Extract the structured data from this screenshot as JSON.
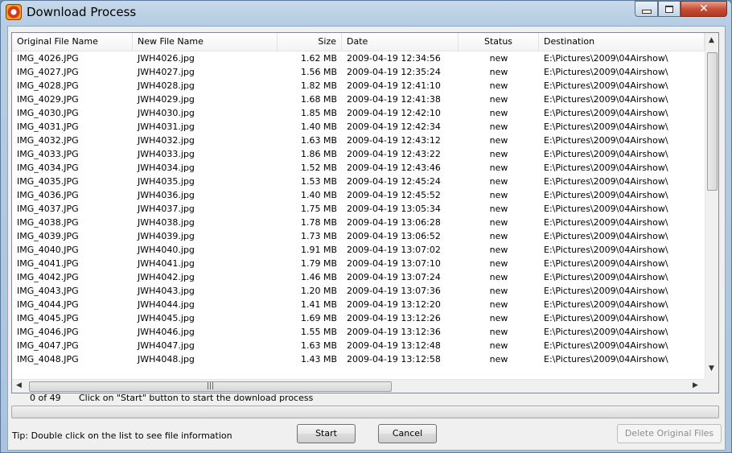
{
  "window": {
    "title": "Download Process",
    "title_color": "#000000",
    "accent": "#5b7799"
  },
  "icons": {
    "app": "app-icon",
    "minimize": "minimize-icon",
    "maximize": "maximize-icon",
    "close": "close-icon"
  },
  "table": {
    "columns": [
      "Original File Name",
      "New File Name",
      "Size",
      "Date",
      "Status",
      "Destination"
    ],
    "rows": [
      [
        "IMG_4026.JPG",
        "JWH4026.jpg",
        "1.62 MB",
        "2009-04-19 12:34:56",
        "new",
        "E:\\Pictures\\2009\\04Airshow\\"
      ],
      [
        "IMG_4027.JPG",
        "JWH4027.jpg",
        "1.56 MB",
        "2009-04-19 12:35:24",
        "new",
        "E:\\Pictures\\2009\\04Airshow\\"
      ],
      [
        "IMG_4028.JPG",
        "JWH4028.jpg",
        "1.82 MB",
        "2009-04-19 12:41:10",
        "new",
        "E:\\Pictures\\2009\\04Airshow\\"
      ],
      [
        "IMG_4029.JPG",
        "JWH4029.jpg",
        "1.68 MB",
        "2009-04-19 12:41:38",
        "new",
        "E:\\Pictures\\2009\\04Airshow\\"
      ],
      [
        "IMG_4030.JPG",
        "JWH4030.jpg",
        "1.85 MB",
        "2009-04-19 12:42:10",
        "new",
        "E:\\Pictures\\2009\\04Airshow\\"
      ],
      [
        "IMG_4031.JPG",
        "JWH4031.jpg",
        "1.40 MB",
        "2009-04-19 12:42:34",
        "new",
        "E:\\Pictures\\2009\\04Airshow\\"
      ],
      [
        "IMG_4032.JPG",
        "JWH4032.jpg",
        "1.63 MB",
        "2009-04-19 12:43:12",
        "new",
        "E:\\Pictures\\2009\\04Airshow\\"
      ],
      [
        "IMG_4033.JPG",
        "JWH4033.jpg",
        "1.86 MB",
        "2009-04-19 12:43:22",
        "new",
        "E:\\Pictures\\2009\\04Airshow\\"
      ],
      [
        "IMG_4034.JPG",
        "JWH4034.jpg",
        "1.52 MB",
        "2009-04-19 12:43:46",
        "new",
        "E:\\Pictures\\2009\\04Airshow\\"
      ],
      [
        "IMG_4035.JPG",
        "JWH4035.jpg",
        "1.53 MB",
        "2009-04-19 12:45:24",
        "new",
        "E:\\Pictures\\2009\\04Airshow\\"
      ],
      [
        "IMG_4036.JPG",
        "JWH4036.jpg",
        "1.40 MB",
        "2009-04-19 12:45:52",
        "new",
        "E:\\Pictures\\2009\\04Airshow\\"
      ],
      [
        "IMG_4037.JPG",
        "JWH4037.jpg",
        "1.75 MB",
        "2009-04-19 13:05:34",
        "new",
        "E:\\Pictures\\2009\\04Airshow\\"
      ],
      [
        "IMG_4038.JPG",
        "JWH4038.jpg",
        "1.78 MB",
        "2009-04-19 13:06:28",
        "new",
        "E:\\Pictures\\2009\\04Airshow\\"
      ],
      [
        "IMG_4039.JPG",
        "JWH4039.jpg",
        "1.73 MB",
        "2009-04-19 13:06:52",
        "new",
        "E:\\Pictures\\2009\\04Airshow\\"
      ],
      [
        "IMG_4040.JPG",
        "JWH4040.jpg",
        "1.91 MB",
        "2009-04-19 13:07:02",
        "new",
        "E:\\Pictures\\2009\\04Airshow\\"
      ],
      [
        "IMG_4041.JPG",
        "JWH4041.jpg",
        "1.79 MB",
        "2009-04-19 13:07:10",
        "new",
        "E:\\Pictures\\2009\\04Airshow\\"
      ],
      [
        "IMG_4042.JPG",
        "JWH4042.jpg",
        "1.46 MB",
        "2009-04-19 13:07:24",
        "new",
        "E:\\Pictures\\2009\\04Airshow\\"
      ],
      [
        "IMG_4043.JPG",
        "JWH4043.jpg",
        "1.20 MB",
        "2009-04-19 13:07:36",
        "new",
        "E:\\Pictures\\2009\\04Airshow\\"
      ],
      [
        "IMG_4044.JPG",
        "JWH4044.jpg",
        "1.41 MB",
        "2009-04-19 13:12:20",
        "new",
        "E:\\Pictures\\2009\\04Airshow\\"
      ],
      [
        "IMG_4045.JPG",
        "JWH4045.jpg",
        "1.69 MB",
        "2009-04-19 13:12:26",
        "new",
        "E:\\Pictures\\2009\\04Airshow\\"
      ],
      [
        "IMG_4046.JPG",
        "JWH4046.jpg",
        "1.55 MB",
        "2009-04-19 13:12:36",
        "new",
        "E:\\Pictures\\2009\\04Airshow\\"
      ],
      [
        "IMG_4047.JPG",
        "JWH4047.jpg",
        "1.63 MB",
        "2009-04-19 13:12:48",
        "new",
        "E:\\Pictures\\2009\\04Airshow\\"
      ],
      [
        "IMG_4048.JPG",
        "JWH4048.jpg",
        "1.43 MB",
        "2009-04-19 13:12:58",
        "new",
        "E:\\Pictures\\2009\\04Airshow\\"
      ]
    ]
  },
  "status": {
    "count": "0 of 49",
    "message": "Click on \"Start\" button to start the download process",
    "progress": 0
  },
  "tip": "Tip: Double click on the list to see file information",
  "buttons": {
    "start": "Start",
    "cancel": "Cancel",
    "delete": "Delete Original Files"
  }
}
